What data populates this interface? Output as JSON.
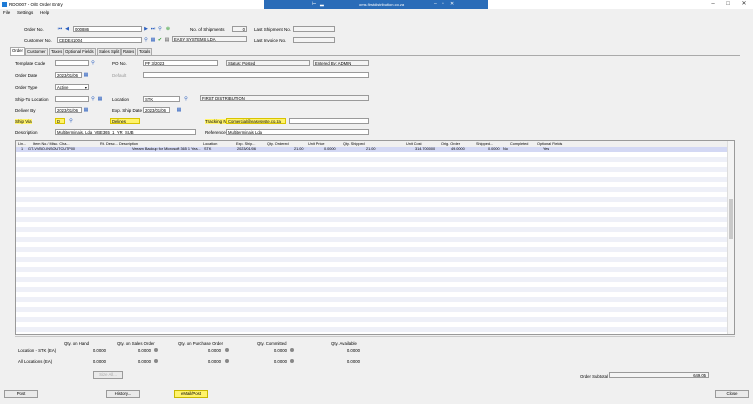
{
  "window": {
    "title": "RDO007 - O/E Order Entry",
    "remote_session_title": "oms.firstdistribution.co.za",
    "controls": {
      "minimize": "–",
      "maximize": "□",
      "close": "✕"
    }
  },
  "menu": [
    "File",
    "Settings",
    "Help"
  ],
  "header": {
    "order_no_label": "Order No.",
    "order_no": "000886",
    "num_shipments_label": "No. of Shipments",
    "num_shipments": "0",
    "last_shipment_label": "Last Shipment No.",
    "last_shipment": "",
    "customer_no_label": "Customer No.",
    "customer_no": "CEDE41004",
    "customer_name": "EASY SYSTEMS LDA",
    "last_invoice_label": "Last Invoice No.",
    "last_invoice": ""
  },
  "tabs": [
    "Order",
    "Customer",
    "Taxes",
    "Optional Fields",
    "Sales Split",
    "Rates",
    "Totals"
  ],
  "form": {
    "template_code_label": "Template Code",
    "template_code": "",
    "po_no_label": "PO No.",
    "po_no": "PF 3/2023",
    "status": "Status: Posted",
    "entered_by": "Entered By: ADMIN",
    "order_date_label": "Order Date",
    "order_date": "2023/01/06",
    "default_label": "Default",
    "order_type_label": "Order Type",
    "order_type": "Active",
    "ship_to_location_label": "Ship-To Location",
    "ship_to_location": "",
    "location_label": "Location",
    "location": "STK",
    "location_desc": "FIRST DISTRIBUTION",
    "deliver_by_label": "Deliver By",
    "deliver_by": "2023/01/06",
    "exp_ship_date_label": "Exp. Ship Date",
    "exp_ship_date": "2023/01/06",
    "ship_via_label": "Ship Via",
    "ship_via": "D",
    "ship_via_desc": "Delines",
    "tracking_no_label": "Tracking No.",
    "tracking_no": "Comercial@easysyste.co.za",
    "description_label": "Description",
    "description": "Multiterminais, Lda_VBE365_1_YR_SUB",
    "reference_label": "Reference",
    "reference": "Multiterminais Lda"
  },
  "grid": {
    "columns": [
      "Lin...",
      "Item No./ Misc. Cha...",
      "Rt.",
      "Desc...",
      "Description",
      "Location",
      "Exp. Ship...",
      "Qty. Ordered",
      "Unit Price",
      "Qty. Shipped",
      "Unit Cost",
      "Orig. Order",
      "Shipped...",
      "Completed",
      "Optional Fields"
    ],
    "rows": [
      [
        "1",
        "GT-VVBO-INSOUTCUTP00",
        "",
        "",
        "Veeam Backup for Microsoft 365 1 Yea...",
        "STK",
        "2023/01/06",
        "21.00",
        "0.0000",
        "21.00",
        "314.700000",
        "49.0000",
        "0.0000",
        "No",
        "Yes"
      ]
    ]
  },
  "stats": {
    "headers": [
      "Qty. on Hand",
      "Qty. on Sales Order",
      "Qty. on Purchase Order",
      "Qty. Committed",
      "Qty. Available"
    ],
    "rows": [
      {
        "label": "Location - STK (EA)",
        "values": [
          "0.0000",
          "0.0000",
          "0.0000",
          "0.0000",
          "0.0000"
        ]
      },
      {
        "label": "All Locations (EA)",
        "values": [
          "0.0000",
          "0.0000",
          "0.0000",
          "0.0000",
          "0.0000"
        ]
      }
    ],
    "sizes_button": "Size All...",
    "subtotal_label": "Order Subtotal",
    "subtotal": "649.05"
  },
  "buttons": {
    "post": "Post",
    "history": "History...",
    "email_post": "eMail/Post",
    "close": "Close"
  }
}
